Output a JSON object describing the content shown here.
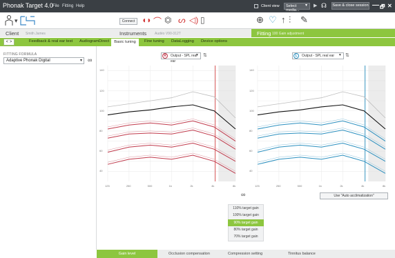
{
  "app": {
    "title": "Phonak Target 4.0",
    "menus": [
      "File",
      "Fitting",
      "Help"
    ],
    "client_view_label": "Client view",
    "media_select": "Select media...",
    "save_close_label": "Save & close session",
    "window_controls": [
      "—",
      "🗗",
      "✕"
    ]
  },
  "toolbar": {
    "connect_label": "Connect",
    "device_icons": [
      "hearing-aid-right-icon",
      "receiver-icon",
      "charger-icon",
      "tube-icon",
      "audio-icon",
      "battery-icon"
    ],
    "fitting_icons": [
      "feedback-test-icon",
      "dome-icon",
      "audiogram-icon",
      "equalizer-icon",
      "tools-icon"
    ]
  },
  "context": {
    "client_label": "Client",
    "client_name": "Smith James",
    "instruments_label": "Instruments",
    "instruments_detail": "Audéo V90-312T",
    "fitting_label": "Fitting",
    "fitting_detail": "100 Gain adjustment"
  },
  "tabs": {
    "nav": "< >",
    "items": [
      "Feedback & real ear test",
      "AudiogramDirect",
      "Basic tuning",
      "Fine tuning",
      "DataLogging",
      "Device options"
    ],
    "active": "Basic tuning"
  },
  "left_panel": {
    "formula_heading": "FITTING FORMULA",
    "formula_value": "Adaptive Phonak Digital"
  },
  "graphs": {
    "right": {
      "badge": "R",
      "output_label": "Output - SPL real ear",
      "color": "#c0394b"
    },
    "left": {
      "badge": "L",
      "output_label": "Output - SPL real ear",
      "color": "#2a8fbf"
    },
    "y_ticks": [
      "140",
      "120",
      "100",
      "80",
      "60",
      "40"
    ],
    "x_ticks": [
      "125",
      "250",
      "500",
      "1k",
      "2k",
      "4k",
      "8k"
    ]
  },
  "chart_data": {
    "type": "line",
    "x": [
      125,
      250,
      500,
      1000,
      2000,
      4000,
      8000
    ],
    "ylim": [
      30,
      145
    ],
    "series": [
      {
        "values": [
          96,
          99,
          101,
          104,
          106,
          100,
          82
        ]
      },
      {
        "values": [
          104,
          107,
          110,
          113,
          119,
          114,
          93
        ]
      },
      {
        "values": [
          82,
          86,
          88,
          86,
          90,
          84,
          70
        ]
      },
      {
        "values": [
          73,
          77,
          78,
          77,
          81,
          75,
          62
        ]
      },
      {
        "values": [
          59,
          64,
          66,
          64,
          68,
          62,
          50
        ]
      },
      {
        "values": [
          47,
          52,
          54,
          52,
          56,
          50,
          38
        ]
      }
    ]
  },
  "auto_acclimatization_label": "Use \"Auto acclimatization\"",
  "gain_levels": {
    "items": [
      "110% target gain",
      "100% target gain",
      "90% target gain",
      "80% target gain",
      "70% target gain"
    ],
    "selected_index": 2
  },
  "bottom_tabs": {
    "items": [
      "Gain level",
      "Occlusion compensation",
      "Compression setting",
      "Tinnitus balance"
    ],
    "active": "Gain level"
  },
  "colors": {
    "accent_green": "#8dc63f",
    "dark_bar": "#3a3f44",
    "right_ear_red": "#c0394b",
    "left_ear_blue": "#2a8fbf"
  }
}
